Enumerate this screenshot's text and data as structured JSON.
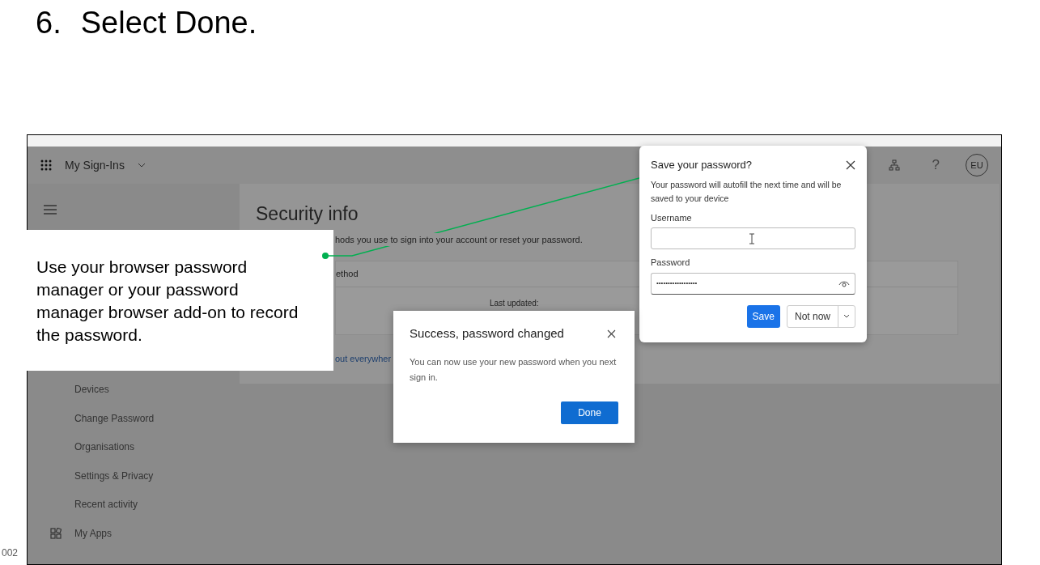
{
  "step": {
    "number": "6.",
    "text": "Select **Done**."
  },
  "app": {
    "title": "My Sign-Ins",
    "help": "?",
    "avatar": "EU",
    "page_title": "Security info",
    "subtitle": "hods you use to sign into your account or reset your password.",
    "table": {
      "column_1": "ethod",
      "cell": "Last updated:"
    },
    "link": "out everywher",
    "sidebar": [
      {
        "label": "Devices",
        "kind": "text"
      },
      {
        "label": "Change Password",
        "kind": "text"
      },
      {
        "label": "Organisations",
        "kind": "text"
      },
      {
        "label": "Settings & Privacy",
        "kind": "text"
      },
      {
        "label": "Recent activity",
        "kind": "text"
      },
      {
        "label": "My Apps",
        "kind": "apps"
      }
    ]
  },
  "callout": "Use your browser password manager or your password manager browser add-on to record the password.",
  "save_popup": {
    "title": "Save your password?",
    "description": "Your password will autofill the next time and will be saved to your device",
    "username_label": "Username",
    "password_label": "Password",
    "password_value": "••••••••••••••••••",
    "buttons": [
      "Save",
      "Not now"
    ]
  },
  "dialog": {
    "title": "Success, password changed",
    "body": "You can now use your new password when you next sign in.",
    "button": "Done"
  },
  "footer": "002"
}
